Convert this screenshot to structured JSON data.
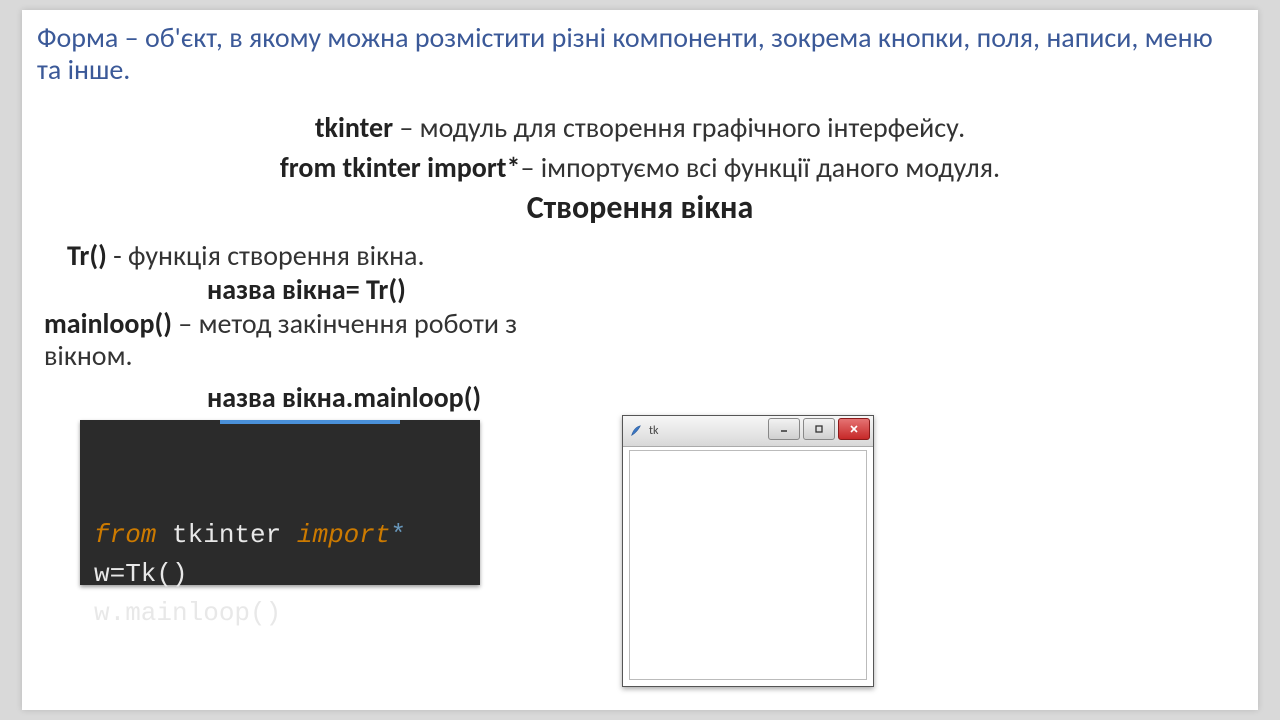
{
  "intro_blue": "Форма – об'єкт, в якому можна розмістити різні компоненти, зокрема кнопки, поля, написи, меню та інше.",
  "tkinter_bold": "tkinter",
  "tkinter_rest": " – модуль для створення графічного інтерфейсу.",
  "import_bold": "from tkinter  import*",
  "import_rest": "– імпортуємо всі функції даного модуля.",
  "heading": "Створення вікна",
  "tr_bold": "Tr()",
  "tr_rest": " - функція створення вікна.",
  "nazva1": "назва вікна= Tr()",
  "mainloop_bold": "mainloop()",
  "mainloop_rest": " – метод закінчення роботи з вікном.",
  "nazva2": "назва вікна.mainloop()",
  "code": {
    "c1_from": "from",
    "c1_mod": " tkinter ",
    "c1_import": "import",
    "c1_star": "*",
    "c2": "w=Tk()",
    "c3": "w.mainloop()"
  },
  "tkwin": {
    "title": "tk"
  }
}
